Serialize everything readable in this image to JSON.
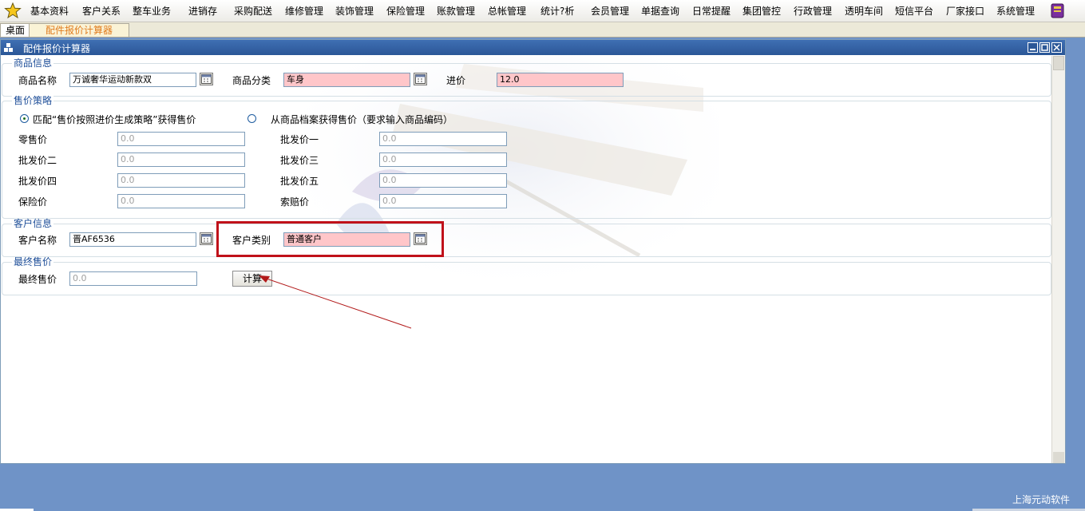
{
  "menu": {
    "items": [
      "基本资料",
      "客户关系",
      "整车业务",
      "进销存",
      "采购配送",
      "维修管理",
      "装饰管理",
      "保险管理",
      "账款管理",
      "总帐管理",
      "统计?析",
      "会员管理",
      "单据查询",
      "日常提醒",
      "集团管控",
      "行政管理",
      "透明车间",
      "短信平台",
      "厂家接口",
      "系统管理"
    ],
    "star_icon": "star-icon",
    "right_icon": "book-icon"
  },
  "tabs": {
    "desktop": "桌面",
    "active": "配件报价计算器"
  },
  "window": {
    "title": "配件报价计算器"
  },
  "product": {
    "legend": "商品信息",
    "name_label": "商品名称",
    "name_value": "万诚奢华运动新款双",
    "category_label": "商品分类",
    "category_value": "车身",
    "cost_label": "进价",
    "cost_value": "12.0"
  },
  "strategy": {
    "legend": "售价策略",
    "option1": "匹配“售价按照进价生成策略”获得售价",
    "option2": "从商品档案获得售价（要求输入商品编码）",
    "selected": "option1",
    "fields": {
      "retail": {
        "label": "零售价",
        "value": "0.0"
      },
      "w1": {
        "label": "批发价一",
        "value": "0.0"
      },
      "w2": {
        "label": "批发价二",
        "value": "0.0"
      },
      "w3": {
        "label": "批发价三",
        "value": "0.0"
      },
      "w4": {
        "label": "批发价四",
        "value": "0.0"
      },
      "w5": {
        "label": "批发价五",
        "value": "0.0"
      },
      "insurance": {
        "label": "保险价",
        "value": "0.0"
      },
      "claim": {
        "label": "索赔价",
        "value": "0.0"
      }
    }
  },
  "customer": {
    "legend": "客户信息",
    "name_label": "客户名称",
    "name_value": "晋AF6536",
    "type_label": "客户类别",
    "type_value": "普通客户"
  },
  "final": {
    "legend": "最终售价",
    "label": "最终售价",
    "value": "0.0",
    "calc_button": "计算"
  },
  "footer": {
    "brand": "上海元动软件"
  },
  "colors": {
    "titlebar": "#2b5797",
    "required_field": "#ffc6c9",
    "highlight": "#c0111a",
    "desktop_bg": "#6f93c7"
  }
}
